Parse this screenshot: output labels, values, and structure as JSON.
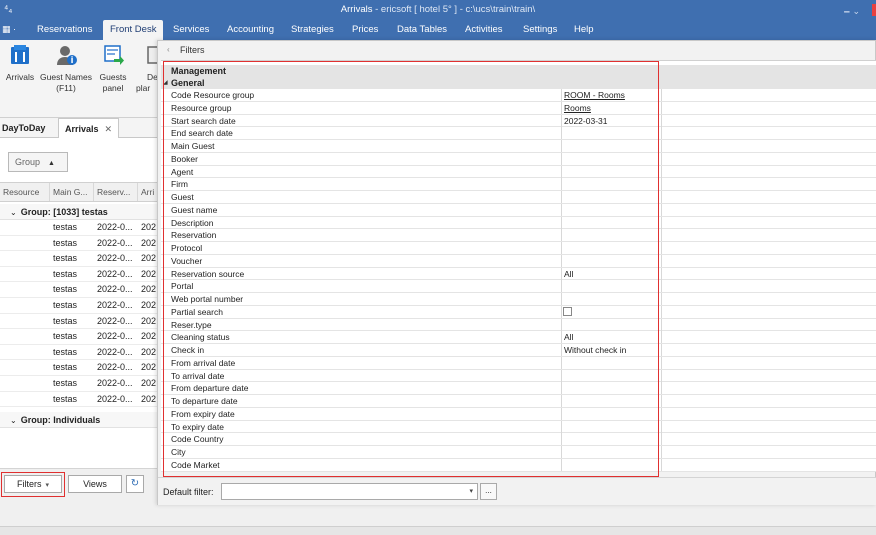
{
  "window": {
    "title_prefix": "Arrivals",
    "title_rest": " - ericsoft [ hotel 5° ] - c:\\ucs\\train\\train\\"
  },
  "menu": [
    {
      "label": "Reservations",
      "active": false
    },
    {
      "label": "Front Desk",
      "active": true
    },
    {
      "label": "Services",
      "active": false
    },
    {
      "label": "Accounting",
      "active": false
    },
    {
      "label": "Strategies",
      "active": false
    },
    {
      "label": "Prices",
      "active": false
    },
    {
      "label": "Data Tables",
      "active": false
    },
    {
      "label": "Activities",
      "active": false
    },
    {
      "label": "Settings",
      "active": false
    },
    {
      "label": "Help",
      "active": false
    }
  ],
  "ribbon": {
    "arrivals": "Arrivals",
    "guest_names_1": "Guest Names",
    "guest_names_2": "(F11)",
    "guests_panel_1": "Guests",
    "guests_panel_2": "panel",
    "partial_1": "De",
    "partial_2": "plar"
  },
  "doc_tabs": {
    "daytoday": "DayToDay",
    "arrivals": "Arrivals",
    "close": "✕"
  },
  "grid": {
    "group_box": "Group",
    "columns": [
      "Resource",
      "Main G...",
      "Reserv...",
      "Arri"
    ],
    "group1": "Group: [1033] testas",
    "rows": [
      [
        "",
        "testas",
        "2022-0...",
        "202"
      ],
      [
        "",
        "testas",
        "2022-0...",
        "202"
      ],
      [
        "",
        "testas",
        "2022-0...",
        "202"
      ],
      [
        "",
        "testas",
        "2022-0...",
        "202"
      ],
      [
        "",
        "testas",
        "2022-0...",
        "202"
      ],
      [
        "",
        "testas",
        "2022-0...",
        "202"
      ],
      [
        "",
        "testas",
        "2022-0...",
        "202"
      ],
      [
        "",
        "testas",
        "2022-0...",
        "202"
      ],
      [
        "",
        "testas",
        "2022-0...",
        "202"
      ],
      [
        "",
        "testas",
        "2022-0...",
        "202"
      ],
      [
        "",
        "testas",
        "2022-0...",
        "202"
      ],
      [
        "",
        "testas",
        "2022-0...",
        "202"
      ]
    ],
    "group2": "Group: Individuals"
  },
  "bottom": {
    "filters_label": "Filters",
    "views_label": "Views"
  },
  "filters_panel": {
    "title": "Filters",
    "cat_management": "Management",
    "cat_general": "General",
    "properties": [
      {
        "name": "Code Resource group",
        "value": "ROOM - Rooms",
        "link": true
      },
      {
        "name": "Resource group",
        "value": "Rooms",
        "link": true
      },
      {
        "name": "Start search date",
        "value": "2022-03-31"
      },
      {
        "name": "End search date",
        "value": ""
      },
      {
        "name": "Main Guest",
        "value": ""
      },
      {
        "name": "Booker",
        "value": ""
      },
      {
        "name": "Agent",
        "value": ""
      },
      {
        "name": "Firm",
        "value": ""
      },
      {
        "name": "Guest",
        "value": ""
      },
      {
        "name": "Guest name",
        "value": ""
      },
      {
        "name": "Description",
        "value": ""
      },
      {
        "name": "Reservation",
        "value": ""
      },
      {
        "name": "Protocol",
        "value": ""
      },
      {
        "name": "Voucher",
        "value": ""
      },
      {
        "name": "Reservation source",
        "value": "All"
      },
      {
        "name": "Portal",
        "value": ""
      },
      {
        "name": "Web portal number",
        "value": ""
      },
      {
        "name": "Partial search",
        "value": "",
        "checkbox": true
      },
      {
        "name": "Reser.type",
        "value": ""
      },
      {
        "name": "Cleaning status",
        "value": "All"
      },
      {
        "name": "Check in",
        "value": "Without check in"
      },
      {
        "name": "From arrival date",
        "value": ""
      },
      {
        "name": "To arrival date",
        "value": ""
      },
      {
        "name": "From departure date",
        "value": ""
      },
      {
        "name": "To departure date",
        "value": ""
      },
      {
        "name": "From expiry date",
        "value": ""
      },
      {
        "name": "To expiry date",
        "value": ""
      },
      {
        "name": "Code Country",
        "value": ""
      },
      {
        "name": "City",
        "value": ""
      },
      {
        "name": "Code Market",
        "value": ""
      }
    ],
    "default_filter_label": "Default filter:",
    "default_filter_value": "",
    "more_label": "..."
  },
  "colors": {
    "titlebar": "#3f6fb0",
    "highlight": "#e03030"
  }
}
